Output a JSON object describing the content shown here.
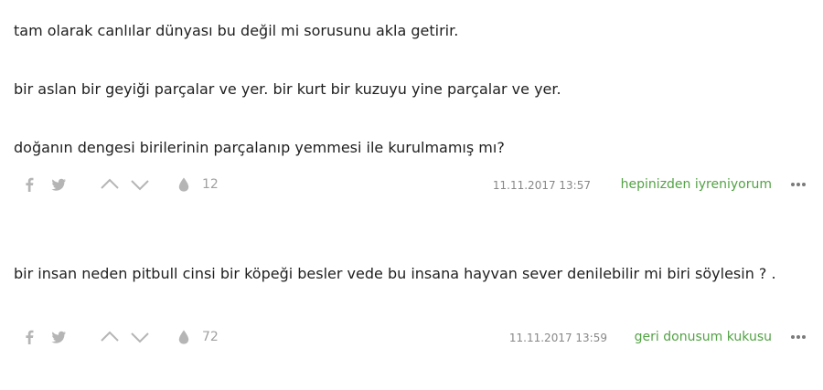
{
  "entries": [
    {
      "paragraphs": [
        "tam olarak canlılar dünyası bu değil mi sorusunu akla getirir.",
        "bir aslan bir geyiği parçalar ve yer. bir kurt bir kuzuyu yine parçalar ve yer.",
        "doğanın dengesi birilerinin parçalanıp yemmesi ile kurulmamış mı?"
      ],
      "favorite_count": "12",
      "date": "11.11.2017 13:57",
      "author": "hepinizden iyreniyorum"
    },
    {
      "paragraphs": [
        "bir insan neden pitbull cinsi bir köpeği besler vede bu insana hayvan sever denilebilir mi biri söylesin ? ."
      ],
      "favorite_count": "72",
      "date": "11.11.2017 13:59",
      "author": "geri donusum kukusu"
    }
  ],
  "icons": {
    "share_facebook": "facebook-icon",
    "share_twitter": "twitter-icon",
    "upvote": "chevron-up-icon",
    "downvote": "chevron-down-icon",
    "favorite": "drop-icon",
    "more": "more-dots-icon"
  },
  "colors": {
    "text": "#1f1f1f",
    "author": "#53a245",
    "meta": "#888888",
    "icon": "#b5b5b5"
  }
}
